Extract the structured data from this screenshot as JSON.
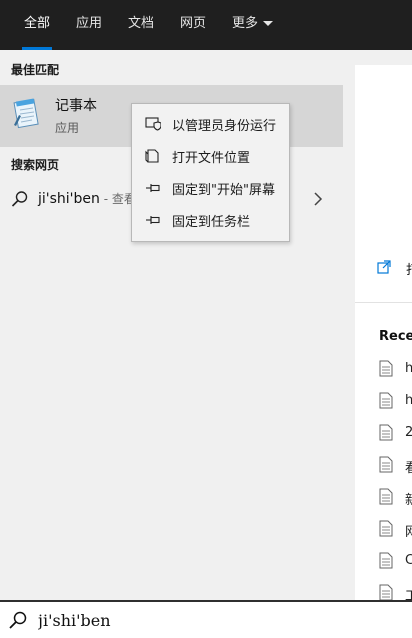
{
  "tabs": [
    {
      "label": "全部",
      "active": true
    },
    {
      "label": "应用"
    },
    {
      "label": "文档"
    },
    {
      "label": "网页"
    },
    {
      "label": "更多"
    }
  ],
  "best_match": {
    "section_title": "最佳匹配",
    "app_name": "记事本",
    "app_type": "应用",
    "icon": "notepad-icon"
  },
  "web_search": {
    "section_title": "搜索网页",
    "query": "ji'shi'ben",
    "suffix": " - 查看"
  },
  "context_menu": [
    {
      "label": "以管理员身份运行",
      "icon": "admin-shield-icon"
    },
    {
      "label": "打开文件位置",
      "icon": "file-location-icon"
    },
    {
      "label": "固定到\"开始\"屏幕",
      "icon": "pin-icon"
    },
    {
      "label": "固定到任务栏",
      "icon": "pin-icon"
    }
  ],
  "preview": {
    "open_label": "打",
    "recent_title": "Recen",
    "recent_items": [
      "h",
      "h",
      "2",
      "看",
      "新",
      "网",
      "C",
      "工"
    ]
  },
  "search_box": {
    "value": "ji'shi'ben"
  },
  "colors": {
    "accent": "#0078d7",
    "topbar": "#1f1f1f",
    "highlight": "#d6d6d6"
  }
}
